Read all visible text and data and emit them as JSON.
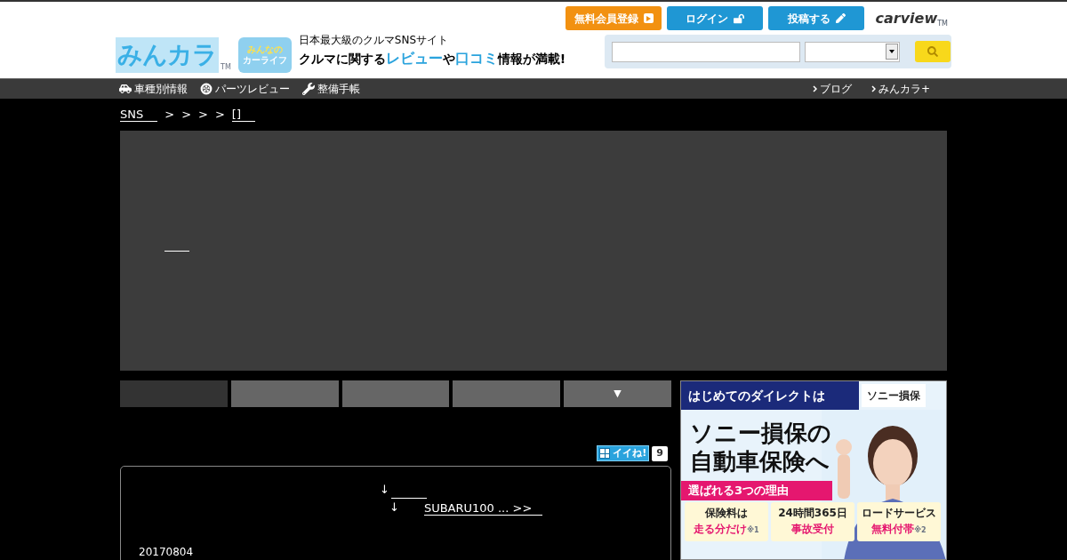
{
  "header": {
    "logo": {
      "text": "みんカラ",
      "tm": "TM",
      "badge": [
        "みんなの",
        "カーライフ"
      ]
    },
    "tagline": "日本最大級のクルマSNSサイト",
    "slogan": [
      {
        "text": "クルマに関する",
        "highlight": false
      },
      {
        "text": "レビュー",
        "highlight": true
      },
      {
        "text": "や",
        "highlight": false
      },
      {
        "text": "口コミ",
        "highlight": true
      },
      {
        "text": "情報が満載!",
        "highlight": false
      }
    ],
    "buttons": [
      {
        "label": "無料会員登録",
        "kind": "register"
      },
      {
        "label": "ログイン",
        "kind": "login"
      },
      {
        "label": "投稿する",
        "kind": "post"
      }
    ],
    "partner": {
      "text": "carview",
      "tm": "TM"
    }
  },
  "nav": {
    "left": [
      {
        "label": "車種別情報",
        "kind": "car"
      },
      {
        "label": "パーツレビュー",
        "kind": "parts"
      },
      {
        "label": "整備手帳",
        "kind": "wrench"
      }
    ],
    "right": [
      {
        "label": "ブログ"
      },
      {
        "label": "みんカラ+"
      }
    ]
  },
  "breadcrumb": [
    {
      "text": "SNS",
      "kind": "link"
    },
    {
      "text": ">",
      "kind": "sep"
    },
    {
      "text": ">",
      "kind": "sep"
    },
    {
      "text": ">",
      "kind": "sep"
    },
    {
      "text": ">",
      "kind": "sep"
    },
    {
      "text": "[]",
      "kind": "link"
    }
  ],
  "tabs": [
    {
      "selected": true
    },
    {
      "selected": false
    },
    {
      "selected": false
    },
    {
      "selected": false
    },
    {
      "label": "▼",
      "selected": false
    }
  ],
  "like": {
    "label": "イイね!",
    "count": "9"
  },
  "post": {
    "lines": [
      {
        "mark": "↓"
      },
      {
        "mark": "↓",
        "link": "SUBARU100 ... >>"
      }
    ],
    "date": "20170804"
  },
  "ad": {
    "lead": "はじめてのダイレクトは",
    "brand": "ソニー損保",
    "headline": [
      "ソニー損保の",
      "自動車保険へ"
    ],
    "tag": "選ばれる3つの理由",
    "cards": [
      {
        "top": "保険料は",
        "bottom": "走る分だけ",
        "note": "※1"
      },
      {
        "top": "24時間365日",
        "bottom": "事故受付"
      },
      {
        "top": "ロードサービス",
        "bottom": "無料付帯",
        "note": "※2"
      }
    ]
  }
}
